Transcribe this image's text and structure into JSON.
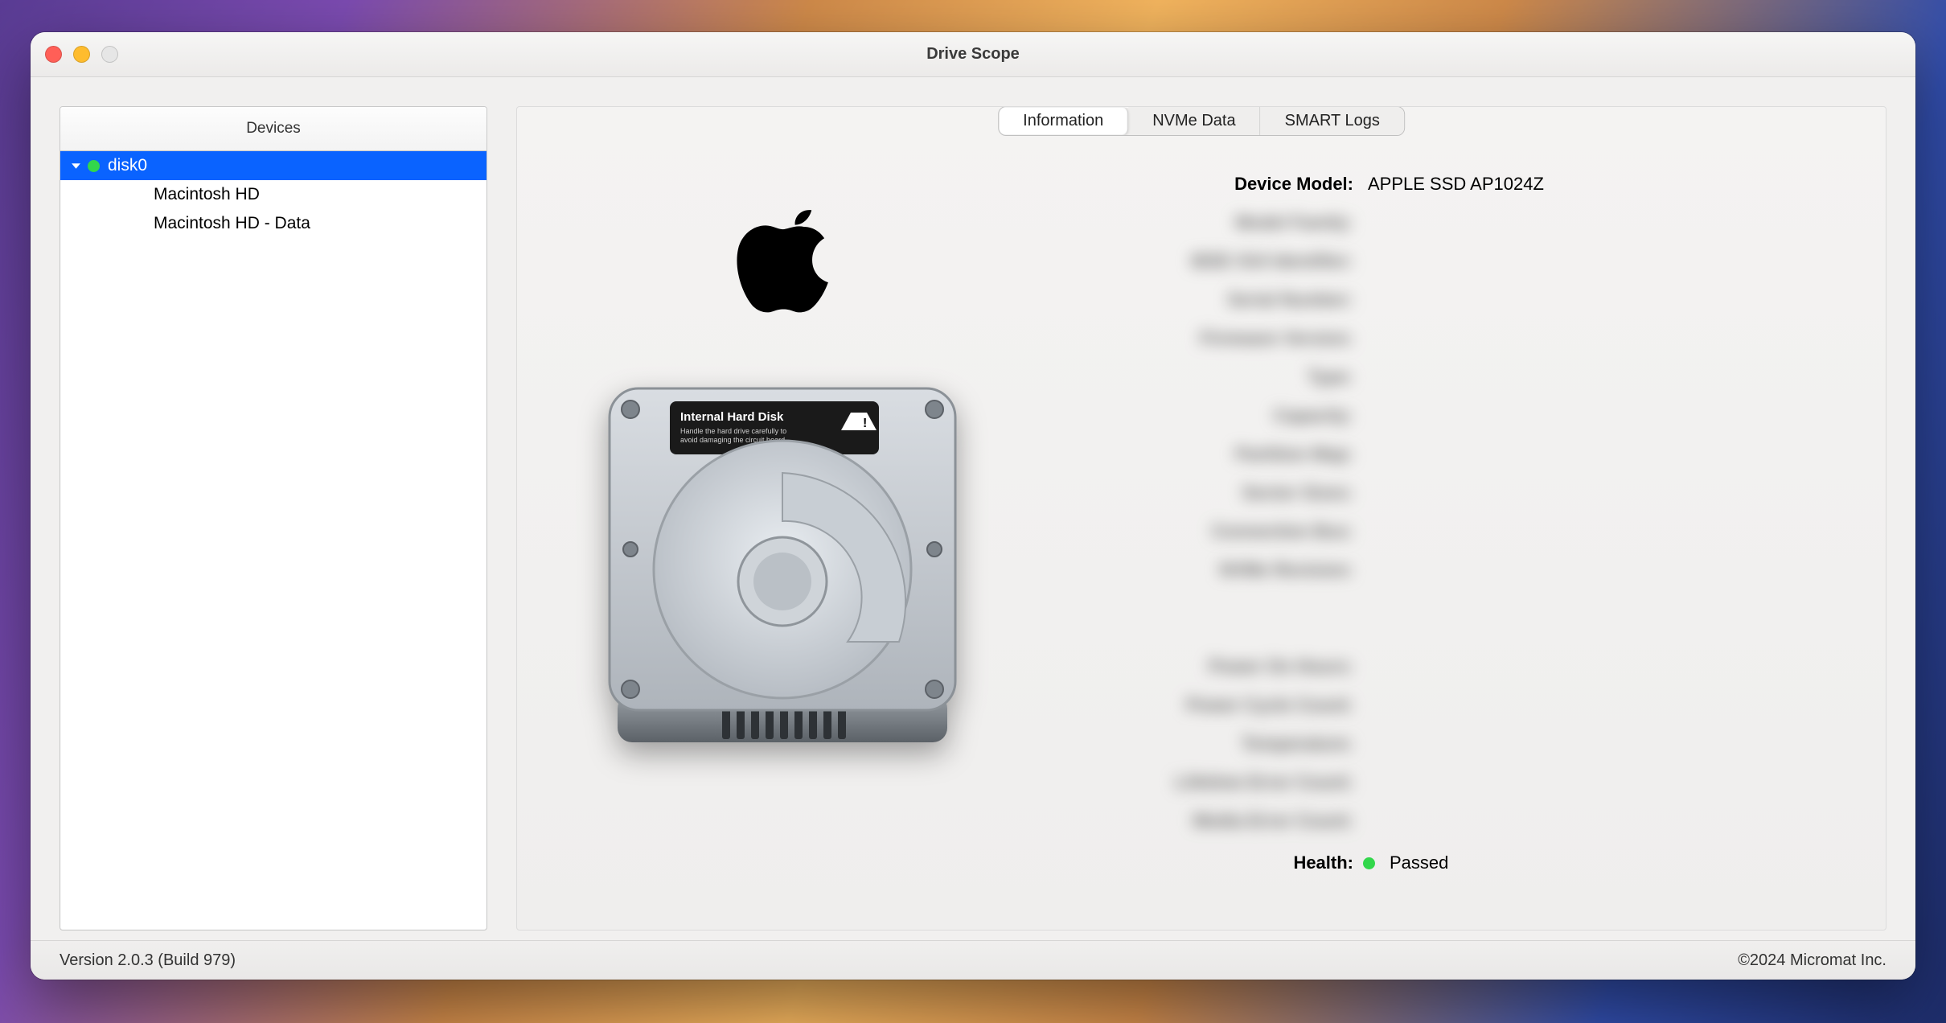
{
  "window": {
    "title": "Drive Scope"
  },
  "sidebar": {
    "header": "Devices",
    "root": {
      "label": "disk0",
      "status": "green",
      "expanded": true
    },
    "children": [
      {
        "label": "Macintosh HD"
      },
      {
        "label": "Macintosh HD - Data"
      }
    ]
  },
  "tabs": {
    "items": [
      "Information",
      "NVMe Data",
      "SMART Logs"
    ],
    "active": 0
  },
  "info": {
    "device_model": {
      "label": "Device Model:",
      "value": "APPLE SSD AP1024Z",
      "blurred": false
    },
    "model_family": {
      "label": "Model Family:",
      "value": " ",
      "blurred": true
    },
    "ieee_oui": {
      "label": "IEEE OUI Identifier:",
      "value": " ",
      "blurred": true
    },
    "serial_number": {
      "label": "Serial Number:",
      "value": " ",
      "blurred": true
    },
    "firmware_version": {
      "label": "Firmware Version:",
      "value": " ",
      "blurred": true
    },
    "type": {
      "label": "Type:",
      "value": " ",
      "blurred": true
    },
    "capacity": {
      "label": "Capacity:",
      "value": " ",
      "blurred": true
    },
    "partition_map": {
      "label": "Partition Map:",
      "value": " ",
      "blurred": true
    },
    "sector_sizes": {
      "label": "Sector Sizes:",
      "value": " ",
      "blurred": true
    },
    "connection_bus": {
      "label": "Connection Bus:",
      "value": " ",
      "blurred": true
    },
    "nvme_revision": {
      "label": "NVMe Revision:",
      "value": " ",
      "blurred": true
    },
    "power_on_hours": {
      "label": "Power On Hours:",
      "value": " ",
      "blurred": true
    },
    "power_cycle_count": {
      "label": "Power Cycle Count:",
      "value": " ",
      "blurred": true
    },
    "temperature": {
      "label": "Temperature:",
      "value": " ",
      "blurred": true
    },
    "lifetime_error": {
      "label": "Lifetime Error Count:",
      "value": " ",
      "blurred": true
    },
    "media_error": {
      "label": "Media Error Count:",
      "value": " ",
      "blurred": true
    }
  },
  "health": {
    "label": "Health:",
    "status_color": "green",
    "value": "Passed"
  },
  "footer": {
    "version": "Version 2.0.3 (Build 979)",
    "copyright": "©2024 Micromat Inc."
  },
  "icons": {
    "apple": "apple-logo-icon",
    "hdd": "internal-hard-disk-icon"
  }
}
